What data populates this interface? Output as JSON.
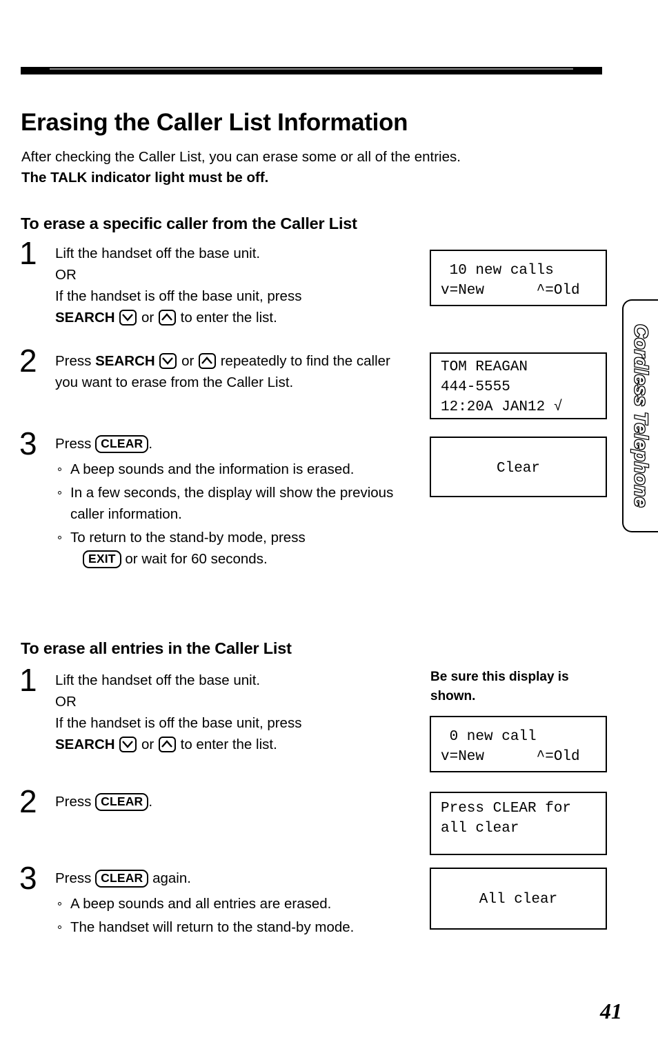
{
  "page": {
    "title": "Erasing the Caller List Information",
    "page_number": "41",
    "side_tab_label": "Cordless Telephone"
  },
  "intro": {
    "line1": "After checking the Caller List, you can erase some or all of the entries.",
    "line2": "The TALK indicator light must be off."
  },
  "keys": {
    "search_label": "SEARCH",
    "down_key": "down-arrow-key",
    "up_key": "up-arrow-key",
    "clear_label": "CLEAR",
    "exit_label": "EXIT",
    "or_text": "or"
  },
  "section1": {
    "heading": "To erase a specific caller from the Caller List",
    "steps": [
      {
        "number": "1",
        "line1": "Lift the handset off the base unit.",
        "line2": "OR",
        "line3": "If the handset is off the base unit, press",
        "line4_prefix": "SEARCH",
        "line4_mid": "or",
        "line4_suffix": "to enter the list."
      },
      {
        "number": "2",
        "text_prefix": "Press",
        "search": "SEARCH",
        "mid": "or",
        "text_suffix": "repeatedly to find the caller you want to erase from the Caller List."
      },
      {
        "number": "3",
        "text_prefix": "Press",
        "key": "CLEAR",
        "text_suffix": ".",
        "bullets": [
          "A beep sounds and the information is erased.",
          "In a few seconds, the display will show the previous caller information.",
          "To return to the stand-by mode, press"
        ],
        "bullet3_tail": "or wait for 60 seconds.",
        "bullet3_key": "EXIT"
      }
    ],
    "displays": [
      {
        "line1": " 10 new calls",
        "line2": "v=New      ^=Old"
      },
      {
        "line1": "TOM REAGAN",
        "line2": "444-5555",
        "line3": "12:20A JAN12 √"
      },
      {
        "line1": "Clear"
      }
    ]
  },
  "section2": {
    "heading": "To erase all entries in the Caller List",
    "display_note": "Be sure this display is shown.",
    "steps": [
      {
        "number": "1",
        "line1": "Lift the handset off the base unit.",
        "line2": "OR",
        "line3": "If the handset is off the base unit, press",
        "line4_prefix": "SEARCH",
        "line4_mid": "or",
        "line4_suffix": "to enter the list."
      },
      {
        "number": "2",
        "text_prefix": "Press",
        "key": "CLEAR",
        "text_suffix": "."
      },
      {
        "number": "3",
        "text_prefix": "Press",
        "key": "CLEAR",
        "text_suffix": "again.",
        "bullets": [
          "A beep sounds and all entries are erased.",
          "The handset will return to the stand-by mode."
        ]
      }
    ],
    "displays": [
      {
        "line1": " 0 new call",
        "line2": "v=New      ^=Old"
      },
      {
        "line1": "Press CLEAR for",
        "line2": "all clear"
      },
      {
        "line1": "All clear"
      }
    ]
  }
}
